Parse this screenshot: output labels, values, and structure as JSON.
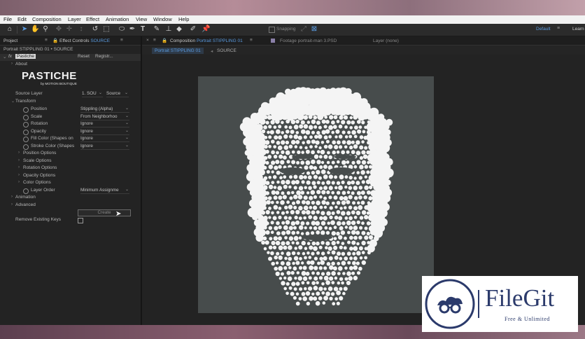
{
  "menu": [
    "File",
    "Edit",
    "Composition",
    "Layer",
    "Effect",
    "Animation",
    "View",
    "Window",
    "Help"
  ],
  "toolbar": {
    "snapping_label": "Snapping",
    "workspace_default": "Default",
    "learn_label": "Learn"
  },
  "left_panel": {
    "project_tab": "Project",
    "effect_controls_tab": "Effect Controls",
    "effect_controls_source": "SOURCE",
    "breadcrumb": "Portrait STIPPLING 01 • SOURCE",
    "effect_name": "Pastiche",
    "reset_label": "Reset",
    "register_label": "Registr...",
    "fx_label": "fx",
    "about_label": "About",
    "brand": "PASTICHE",
    "brand_sub": "by MOTION BOUTIQUE",
    "source_layer_label": "Source Layer",
    "source_layer_value": "1. SOU",
    "source_value": "Source",
    "transform_label": "Transform",
    "properties": [
      {
        "label": "Position",
        "value": "Stippling (Alpha)"
      },
      {
        "label": "Scale",
        "value": "From Neighborhoo"
      },
      {
        "label": "Rotation",
        "value": "Ignore"
      },
      {
        "label": "Opacity",
        "value": "Ignore"
      },
      {
        "label": "Fill Color (Shapes on",
        "value": "Ignore"
      },
      {
        "label": "Stroke Color (Shapes",
        "value": "Ignore"
      }
    ],
    "option_groups": [
      "Position Options",
      "Scale Options",
      "Rotation Options",
      "Opacity Options",
      "Color Options"
    ],
    "layer_order_label": "Layer Order",
    "layer_order_value": "Minimum Assignme",
    "animation_label": "Animation",
    "advanced_label": "Advanced",
    "create_label": "Create",
    "remove_keys_label": "Remove Existing Keys"
  },
  "comp_panel": {
    "composition_prefix": "Composition",
    "composition_name": "Portrait STIPPLING 01",
    "footage_label": "Footage",
    "footage_name": "portrait-man 3.PSD",
    "layer_label": "Layer",
    "layer_value": "(none)",
    "flow_tab_active": "Portrait STIPPLING 01",
    "flow_tab_source": "SOURCE"
  },
  "watermark": {
    "name": "FileGit",
    "tagline": "Free & Unlimited"
  },
  "colors": {
    "accent_blue": "#5a9be0",
    "viewer_bg": "#474c4c",
    "panel_bg": "#232323",
    "brand_navy": "#2b3a6b"
  }
}
